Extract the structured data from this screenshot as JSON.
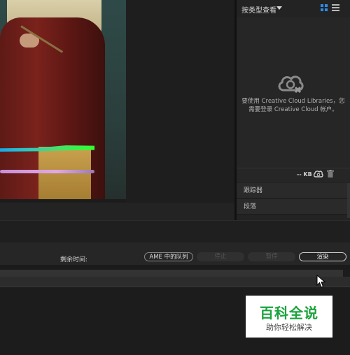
{
  "library_panel": {
    "view_dropdown": "按类型查看",
    "message_line1": "要使用 Creative Cloud Libraries，您",
    "message_line2": "需要登录 Creative Cloud 帐户。",
    "footer_size": "-- KB",
    "accent_color": "#2d8ceb"
  },
  "side_panels": [
    {
      "label": "跟踪器"
    },
    {
      "label": "段落"
    }
  ],
  "render_bar": {
    "time_remaining_label": "剩余时间:",
    "ame_queue_label": "AME 中的队列",
    "stop_label": "停止",
    "pause_label": "暂停",
    "render_label": "渲染"
  },
  "watermark": {
    "title": "百科全说",
    "subtitle": "助你轻松解决",
    "color": "#1aa33d"
  }
}
